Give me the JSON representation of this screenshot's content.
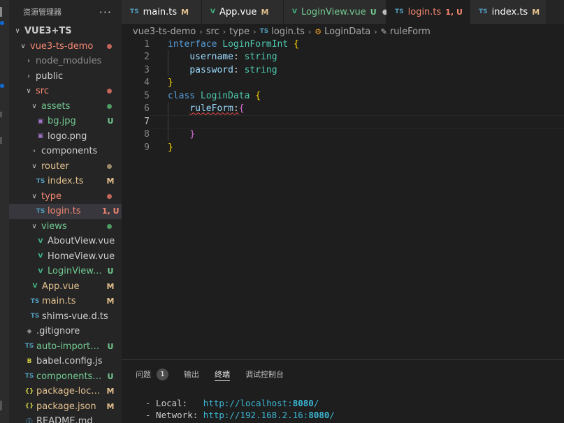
{
  "explorer": {
    "title": "资源管理器",
    "more": "···",
    "items": [
      {
        "label": "VUE3+TS",
        "chevron": "∨",
        "indent": 6,
        "labelClass": "c-plain",
        "bold": true
      },
      {
        "label": "vue3-ts-demo",
        "chevron": "∨",
        "indent": 14,
        "labelClass": "c-err",
        "dot": "#c2665a"
      },
      {
        "label": "node_modules",
        "chevron": "›",
        "indent": 22,
        "labelClass": "c-dim"
      },
      {
        "label": "public",
        "chevron": "›",
        "indent": 22,
        "labelClass": "c-plain"
      },
      {
        "label": "src",
        "chevron": "∨",
        "indent": 22,
        "labelClass": "c-err",
        "dot": "#c2665a"
      },
      {
        "label": "assets",
        "chevron": "∨",
        "indent": 30,
        "labelClass": "c-git-untracked",
        "dot": "#4e9a63"
      },
      {
        "label": "bg.jpg",
        "icon": "▣",
        "iconClass": "img-ic",
        "indent": 38,
        "labelClass": "c-git-untracked",
        "badge": "U",
        "badgeClass": "c-git-untracked"
      },
      {
        "label": "logo.png",
        "icon": "▣",
        "iconClass": "img-ic",
        "indent": 38,
        "labelClass": "c-plain"
      },
      {
        "label": "components",
        "chevron": "›",
        "indent": 30,
        "labelClass": "c-plain"
      },
      {
        "label": "router",
        "chevron": "∨",
        "indent": 30,
        "labelClass": "c-git-mod",
        "dot": "#9a8a6a"
      },
      {
        "label": "index.ts",
        "icon": "TS",
        "iconClass": "ts-ic",
        "indent": 38,
        "labelClass": "c-git-mod",
        "badge": "M",
        "badgeClass": "c-git-mod"
      },
      {
        "label": "type",
        "chevron": "∨",
        "indent": 30,
        "labelClass": "c-err",
        "dot": "#c2665a"
      },
      {
        "label": "login.ts",
        "icon": "TS",
        "iconClass": "ts-ic",
        "indent": 38,
        "labelClass": "c-err",
        "badge": "1, U",
        "badgeClass": "c-err",
        "selected": true
      },
      {
        "label": "views",
        "chevron": "∨",
        "indent": 30,
        "labelClass": "c-git-untracked",
        "dot": "#4e9a63"
      },
      {
        "label": "AboutView.vue",
        "icon": "V",
        "iconClass": "vue-ic",
        "indent": 38,
        "labelClass": "c-plain"
      },
      {
        "label": "HomeView.vue",
        "icon": "V",
        "iconClass": "vue-ic",
        "indent": 38,
        "labelClass": "c-plain"
      },
      {
        "label": "LoginView.vue",
        "icon": "V",
        "iconClass": "vue-ic",
        "indent": 38,
        "labelClass": "c-git-untracked",
        "badge": "U",
        "badgeClass": "c-git-untracked"
      },
      {
        "label": "App.vue",
        "icon": "V",
        "iconClass": "vue-ic",
        "indent": 30,
        "labelClass": "c-git-mod",
        "badge": "M",
        "badgeClass": "c-git-mod"
      },
      {
        "label": "main.ts",
        "icon": "TS",
        "iconClass": "ts-ic",
        "indent": 30,
        "labelClass": "c-git-mod",
        "badge": "M",
        "badgeClass": "c-git-mod"
      },
      {
        "label": "shims-vue.d.ts",
        "icon": "TS",
        "iconClass": "ts-ic",
        "indent": 30,
        "labelClass": "c-plain"
      },
      {
        "label": ".gitignore",
        "icon": "◆",
        "iconClass": "git-ic",
        "indent": 22,
        "labelClass": "c-plain"
      },
      {
        "label": "auto-imports.d.ts",
        "icon": "TS",
        "iconClass": "ts-ic",
        "indent": 22,
        "labelClass": "c-git-untracked",
        "badge": "U",
        "badgeClass": "c-git-untracked"
      },
      {
        "label": "babel.config.js",
        "icon": "B",
        "iconClass": "babel-ic",
        "indent": 22,
        "labelClass": "c-plain"
      },
      {
        "label": "components.d.ts",
        "icon": "TS",
        "iconClass": "ts-ic",
        "indent": 22,
        "labelClass": "c-git-untracked",
        "badge": "U",
        "badgeClass": "c-git-untracked"
      },
      {
        "label": "package-lock.j...",
        "icon": "{}",
        "iconClass": "json-ic",
        "indent": 22,
        "labelClass": "c-git-mod",
        "badge": "M",
        "badgeClass": "c-git-mod"
      },
      {
        "label": "package.json",
        "icon": "{}",
        "iconClass": "json-ic",
        "indent": 22,
        "labelClass": "c-git-mod",
        "badge": "M",
        "badgeClass": "c-git-mod"
      },
      {
        "label": "README.md",
        "icon": "ⓘ",
        "iconClass": "ts-ic",
        "indent": 22,
        "labelClass": "c-plain"
      }
    ]
  },
  "tabs": [
    {
      "label": "main.ts",
      "icon": "TS",
      "iconClass": "ts-ic",
      "status": "M",
      "statusClass": "c-git-mod",
      "width": 115
    },
    {
      "label": "App.vue",
      "icon": "V",
      "iconClass": "vue-ic",
      "status": "M",
      "statusClass": "c-git-mod",
      "width": 117
    },
    {
      "label": "LoginView.vue",
      "icon": "V",
      "iconClass": "vue-ic",
      "status": "U",
      "statusClass": "c-git-untracked",
      "width": 147,
      "labelClass": "c-git-untracked",
      "close": "●"
    },
    {
      "label": "login.ts",
      "icon": "TS",
      "iconClass": "ts-ic",
      "status": "1, U",
      "statusClass": "c-err",
      "width": 120,
      "labelClass": "c-err",
      "active": true,
      "modified": true
    },
    {
      "label": "index.ts",
      "icon": "TS",
      "iconClass": "ts-ic",
      "status": "M",
      "statusClass": "c-git-mod",
      "width": 110
    }
  ],
  "breadcrumb": {
    "parts": [
      "vue3-ts-demo",
      "src",
      "type"
    ],
    "file": "login.ts",
    "file_icon": "TS",
    "class_name": "LoginData",
    "member": "ruleForm"
  },
  "editor": {
    "line_numbers": [
      "1",
      "2",
      "3",
      "4",
      "5",
      "6",
      "7",
      "8",
      "9"
    ],
    "current_line": 7,
    "tokens": [
      [
        [
          "kw",
          "interface "
        ],
        [
          "cls",
          "LoginFormInt "
        ],
        [
          "brace",
          "{"
        ]
      ],
      [
        [
          "punc",
          "    "
        ],
        [
          "prop",
          "username"
        ],
        [
          "punc",
          ": "
        ],
        [
          "typ",
          "string"
        ]
      ],
      [
        [
          "punc",
          "    "
        ],
        [
          "prop",
          "password"
        ],
        [
          "punc",
          ": "
        ],
        [
          "typ",
          "string"
        ]
      ],
      [
        [
          "brace",
          "}"
        ]
      ],
      [
        [
          "kw",
          "class "
        ],
        [
          "cls",
          "LoginData "
        ],
        [
          "brace",
          "{"
        ]
      ],
      [
        [
          "punc",
          "    "
        ],
        [
          "prop squig",
          "ruleForm"
        ],
        [
          "punc squig",
          ":"
        ],
        [
          "brace2",
          "{"
        ]
      ],
      [],
      [
        [
          "punc",
          "    "
        ],
        [
          "brace2",
          "}"
        ]
      ],
      [
        [
          "brace",
          "}"
        ]
      ]
    ]
  },
  "panel": {
    "tabs": [
      {
        "label": "问题",
        "count": "1"
      },
      {
        "label": "输出"
      },
      {
        "label": "终端",
        "active": true
      },
      {
        "label": "调试控制台"
      }
    ],
    "terminal": {
      "local_label": "- Local:   ",
      "local_url_prefix": "http://localhost:",
      "local_port": "8080",
      "local_url_suffix": "/",
      "network_label": "- Network: ",
      "network_url_prefix": "http://192.168.2.16:",
      "network_port": "8080",
      "network_url_suffix": "/"
    }
  },
  "colors": {
    "accent": "#0e6ad6",
    "modified": "#e2c08d",
    "untracked": "#73c991",
    "error": "#f48771"
  }
}
